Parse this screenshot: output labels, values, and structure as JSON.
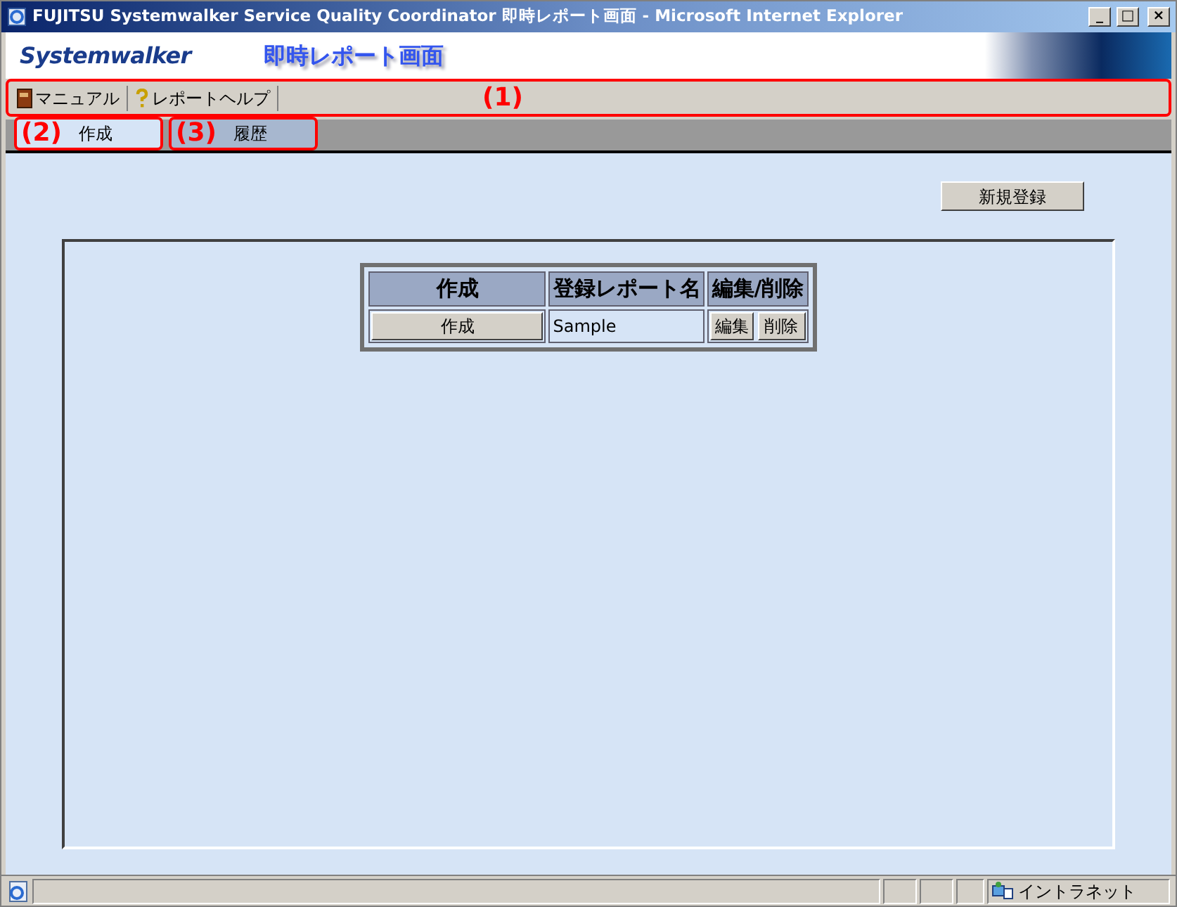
{
  "window": {
    "title": "FUJITSU Systemwalker Service Quality Coordinator 即時レポート画面 - Microsoft Internet Explorer",
    "controls": [
      "_",
      "□",
      "×"
    ]
  },
  "header": {
    "logo": "Systemwalker",
    "page_title": "即時レポート画面"
  },
  "toolbar": {
    "items": [
      {
        "label": "マニュアル",
        "kind": "book"
      },
      {
        "label": "レポートヘルプ",
        "kind": "help"
      }
    ]
  },
  "tabs": [
    {
      "label": "作成",
      "selected": true
    },
    {
      "label": "履歴",
      "selected": false
    }
  ],
  "callouts": [
    {
      "label": "(1)"
    },
    {
      "label": "(2)"
    },
    {
      "label": "(3)"
    }
  ],
  "new_button": "新規登録",
  "table": {
    "columns": [
      "作成",
      "登録レポート名",
      "編集/削除"
    ],
    "rows": [
      {
        "create": "作成",
        "name": "Sample",
        "edit": "編集",
        "delete": "削除"
      }
    ]
  },
  "status_bar": {
    "zone": "イントラネット"
  }
}
